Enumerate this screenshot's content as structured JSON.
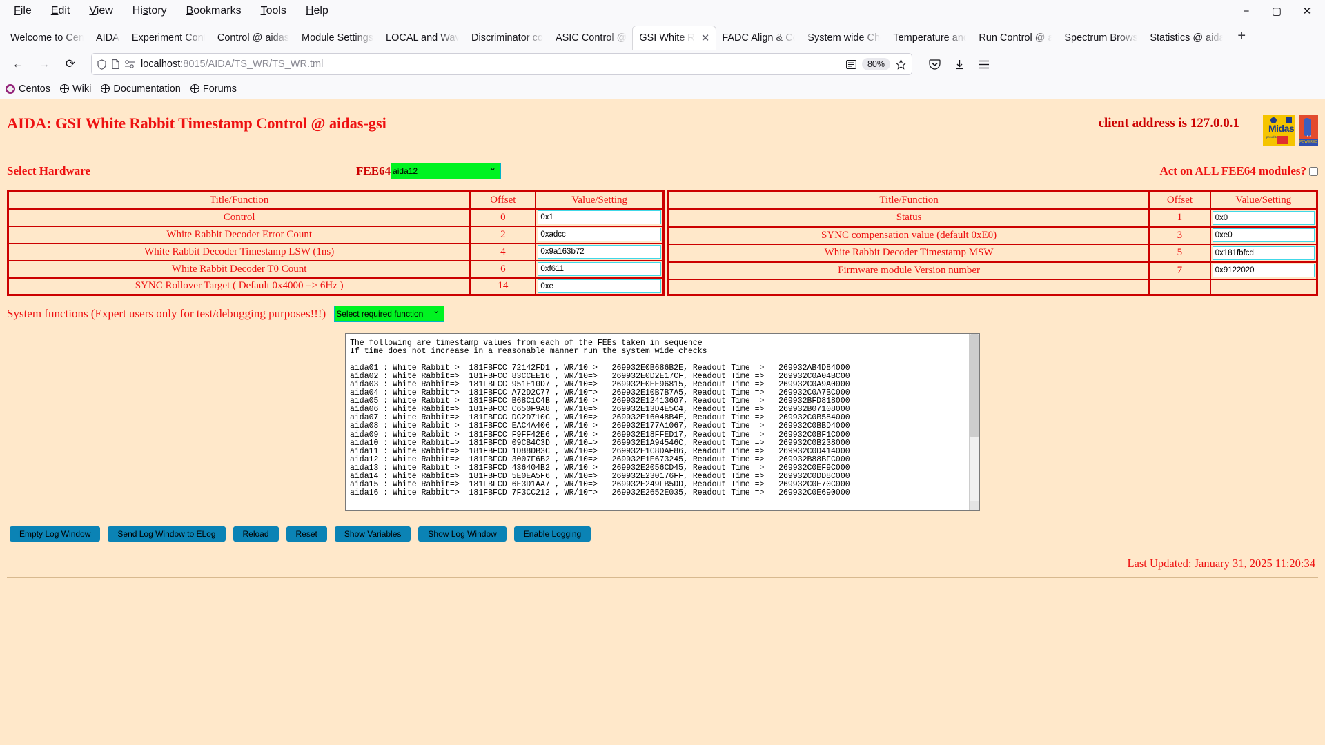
{
  "browser": {
    "menus": [
      "File",
      "Edit",
      "View",
      "History",
      "Bookmarks",
      "Tools",
      "Help"
    ],
    "window_controls": {
      "minimize": "−",
      "maximize": "▢",
      "close": "✕"
    },
    "tabs": [
      {
        "label": "Welcome to Cen",
        "active": false
      },
      {
        "label": "AIDA",
        "active": false,
        "narrow": true
      },
      {
        "label": "Experiment Cont",
        "active": false
      },
      {
        "label": "Control @ aidas",
        "active": false
      },
      {
        "label": "Module Settings",
        "active": false
      },
      {
        "label": "LOCAL and Wave",
        "active": false
      },
      {
        "label": "Discriminator co",
        "active": false
      },
      {
        "label": "ASIC Control @",
        "active": false
      },
      {
        "label": "GSI White Rab",
        "active": true
      },
      {
        "label": "FADC Align & Co",
        "active": false
      },
      {
        "label": "System wide Che",
        "active": false
      },
      {
        "label": "Temperature and",
        "active": false
      },
      {
        "label": "Run Control @ a",
        "active": false
      },
      {
        "label": "Spectrum Brows",
        "active": false
      },
      {
        "label": "Statistics @ aida",
        "active": false
      }
    ],
    "new_tab_label": "+",
    "close_tab_label": "✕",
    "nav": {
      "back": "←",
      "forward": "→",
      "reload": "⟳"
    },
    "url_prefix": "localhost",
    "url_rest": ":8015/AIDA/TS_WR/TS_WR.tml",
    "zoom_level": "80%",
    "bookmarks": [
      {
        "label": "Centos",
        "icon": "centos-icon"
      },
      {
        "label": "Wiki",
        "icon": "globe-icon"
      },
      {
        "label": "Documentation",
        "icon": "globe-icon"
      },
      {
        "label": "Forums",
        "icon": "globe-icon"
      }
    ]
  },
  "page": {
    "title": "AIDA: GSI White Rabbit Timestamp Control @ aidas-gsi",
    "client_address": "client address is 127.0.0.1",
    "logos": {
      "midas_name": "Midas",
      "midas_sub": "proud to",
      "tcl_text": "TCL",
      "tcl_sub": "POWERED"
    },
    "select_hardware_label": "Select Hardware",
    "fee64_label": "FEE64",
    "fee64_value": "aida12",
    "act_on_all_label": "Act on ALL FEE64 modules?",
    "act_on_all_checked": false,
    "table_headers": {
      "title": "Title/Function",
      "offset": "Offset",
      "value": "Value/Setting"
    },
    "table_left": [
      {
        "title": "Control",
        "offset": "0",
        "value": "0x1"
      },
      {
        "title": "White Rabbit Decoder Error Count",
        "offset": "2",
        "value": "0xadcc"
      },
      {
        "title": "White Rabbit Decoder Timestamp LSW (1ns)",
        "offset": "4",
        "value": "0x9a163b72"
      },
      {
        "title": "White Rabbit Decoder T0 Count",
        "offset": "6",
        "value": "0xf611"
      },
      {
        "title": "SYNC Rollover Target ( Default 0x4000 => 6Hz )",
        "offset": "14",
        "value": "0xe"
      }
    ],
    "table_right": [
      {
        "title": "Status",
        "offset": "1",
        "value": "0x0"
      },
      {
        "title": "SYNC compensation value (default 0xE0)",
        "offset": "3",
        "value": "0xe0"
      },
      {
        "title": "White Rabbit Decoder Timestamp MSW",
        "offset": "5",
        "value": "0x181fbfcd"
      },
      {
        "title": "Firmware module Version number",
        "offset": "7",
        "value": "0x9122020"
      }
    ],
    "system_functions_label": "System functions (Expert users only for test/debugging purposes!!!)",
    "system_functions_value": "Select required function",
    "log_text": "The following are timestamp values from each of the FEEs taken in sequence\nIf time does not increase in a reasonable manner run the system wide checks\n\naida01 : White Rabbit=>  181FBFCC 72142FD1 , WR/10=>   269932E0B686B2E, Readout Time =>   269932AB4D84000\naida02 : White Rabbit=>  181FBFCC 83CCEE16 , WR/10=>   269932E0D2E17CF, Readout Time =>   269932C0A04BC00\naida03 : White Rabbit=>  181FBFCC 951E10D7 , WR/10=>   269932E0EE96815, Readout Time =>   269932C0A9A0000\naida04 : White Rabbit=>  181FBFCC A72D2C77 , WR/10=>   269932E10B7B7A5, Readout Time =>   269932C0A7BC000\naida05 : White Rabbit=>  181FBFCC B68C1C4B , WR/10=>   269932E12413607, Readout Time =>   269932BFD818000\naida06 : White Rabbit=>  181FBFCC C650F9A8 , WR/10=>   269932E13D4E5C4, Readout Time =>   269932B07108000\naida07 : White Rabbit=>  181FBFCC DC2D710C , WR/10=>   269932E16048B4E, Readout Time =>   269932C0B584000\naida08 : White Rabbit=>  181FBFCC EAC4A406 , WR/10=>   269932E177A1067, Readout Time =>   269932C0BBD4000\naida09 : White Rabbit=>  181FBFCC F9FF42E6 , WR/10=>   269932E18FFED17, Readout Time =>   269932C0BF1C000\naida10 : White Rabbit=>  181FBFCD 09CB4C3D , WR/10=>   269932E1A94546C, Readout Time =>   269932C0B238000\naida11 : White Rabbit=>  181FBFCD 1D88DB3C , WR/10=>   269932E1C8DAF86, Readout Time =>   269932C0D414000\naida12 : White Rabbit=>  181FBFCD 3007F6B2 , WR/10=>   269932E1E673245, Readout Time =>   269932B88BFC000\naida13 : White Rabbit=>  181FBFCD 436404B2 , WR/10=>   269932E2056CD45, Readout Time =>   269932C0EF9C000\naida14 : White Rabbit=>  181FBFCD 5E0EA5F6 , WR/10=>   269932E230176FF, Readout Time =>   269932C0DD8C000\naida15 : White Rabbit=>  181FBFCD 6E3D1AA7 , WR/10=>   269932E249FB5DD, Readout Time =>   269932C0E70C000\naida16 : White Rabbit=>  181FBFCD 7F3CC212 , WR/10=>   269932E2652E035, Readout Time =>   269932C0E690000",
    "buttons": [
      "Empty Log Window",
      "Send Log Window to ELog",
      "Reload",
      "Reset",
      "Show Variables",
      "Show Log Window",
      "Enable Logging"
    ],
    "last_updated": "Last Updated: January 31, 2025 11:20:34"
  },
  "colors": {
    "page_bg": "#ffe8ca",
    "accent_red": "#ee1111",
    "table_border": "#cc0000",
    "button_blue": "#0b83b5",
    "select_green": "#00f321",
    "input_border": "#40d8e8"
  }
}
